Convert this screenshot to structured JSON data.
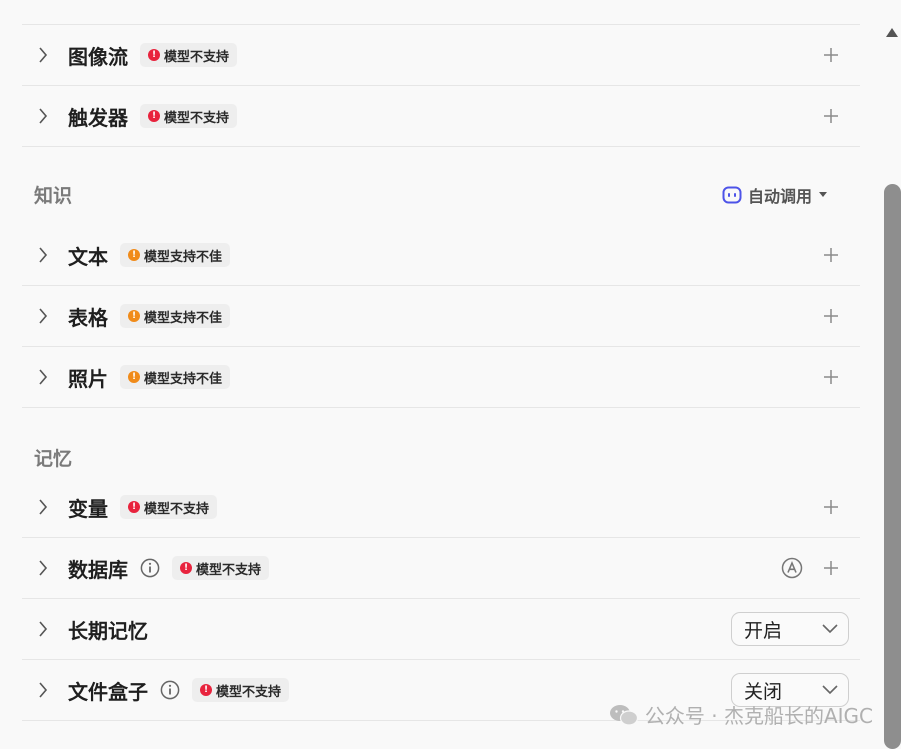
{
  "plugins_top": [
    {
      "title": "图像流",
      "badge": "模型不支持",
      "badge_color": "#e8233d"
    },
    {
      "title": "触发器",
      "badge": "模型不支持",
      "badge_color": "#e8233d"
    }
  ],
  "knowledge": {
    "title": "知识",
    "mode_label": "自动调用",
    "mode_icon": "robot-icon",
    "items": [
      {
        "title": "文本",
        "badge": "模型支持不佳",
        "badge_color": "#f08b1a"
      },
      {
        "title": "表格",
        "badge": "模型支持不佳",
        "badge_color": "#f08b1a"
      },
      {
        "title": "照片",
        "badge": "模型支持不佳",
        "badge_color": "#f08b1a"
      }
    ]
  },
  "memory": {
    "title": "记忆",
    "items": [
      {
        "title": "变量",
        "badge": "模型不支持",
        "badge_color": "#e8233d"
      },
      {
        "title": "数据库",
        "badge": "模型不支持",
        "badge_color": "#e8233d",
        "has_info": true,
        "has_auto": true
      },
      {
        "title": "长期记忆",
        "select_value": "开启"
      },
      {
        "title": "文件盒子",
        "badge": "模型不支持",
        "badge_color": "#e8233d",
        "has_info": true,
        "select_value": "关闭"
      }
    ]
  },
  "watermark": {
    "text": "公众号 · 杰克船长的AIGC"
  },
  "colors": {
    "accent": "#4d53e8",
    "error": "#e8233d",
    "warning": "#f08b1a"
  }
}
